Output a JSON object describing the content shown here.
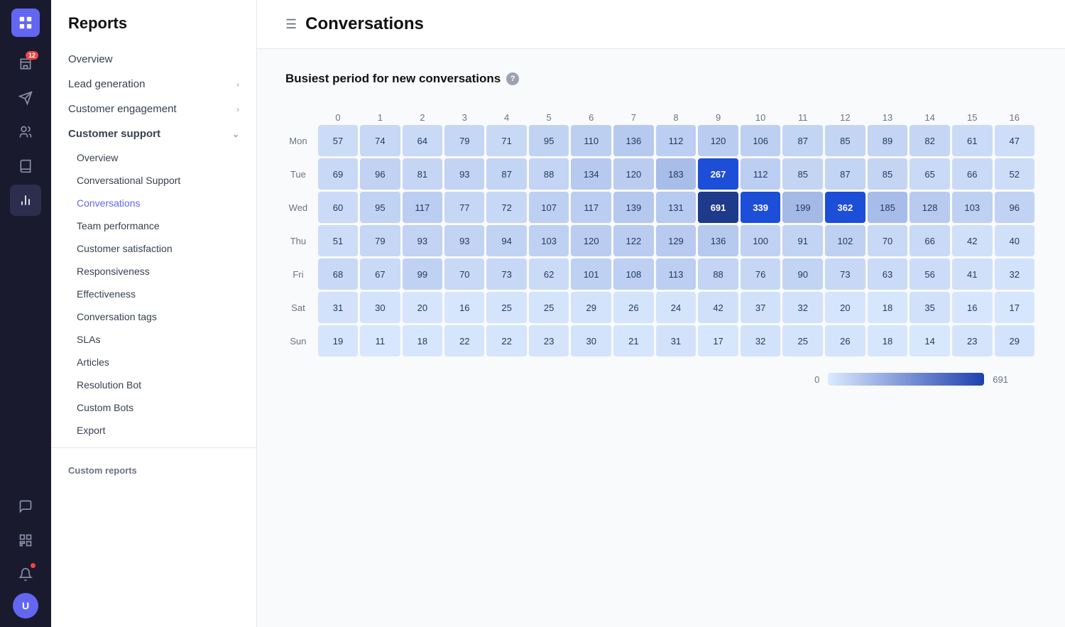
{
  "app": {
    "title": "Reports"
  },
  "icon_sidebar": {
    "badge": "12",
    "nav_icons": [
      {
        "name": "inbox-icon",
        "label": "Inbox",
        "active": false
      },
      {
        "name": "send-icon",
        "label": "Send",
        "active": false
      },
      {
        "name": "contacts-icon",
        "label": "Contacts",
        "active": false
      },
      {
        "name": "knowledge-icon",
        "label": "Knowledge",
        "active": false
      },
      {
        "name": "reports-icon",
        "label": "Reports",
        "active": true
      },
      {
        "name": "apps-icon",
        "label": "Apps",
        "active": false
      }
    ]
  },
  "left_nav": {
    "title": "Reports",
    "items": [
      {
        "label": "Overview",
        "type": "top",
        "active": false
      },
      {
        "label": "Lead generation",
        "type": "top",
        "hasChevron": true,
        "active": false
      },
      {
        "label": "Customer engagement",
        "type": "top",
        "hasChevron": true,
        "active": false
      },
      {
        "label": "Customer support",
        "type": "section",
        "hasChevron": true,
        "active": false
      },
      {
        "label": "Overview",
        "type": "sub",
        "active": false
      },
      {
        "label": "Conversational Support",
        "type": "sub",
        "active": false
      },
      {
        "label": "Conversations",
        "type": "sub",
        "active": true
      },
      {
        "label": "Team performance",
        "type": "sub",
        "active": false
      },
      {
        "label": "Customer satisfaction",
        "type": "sub",
        "active": false
      },
      {
        "label": "Responsiveness",
        "type": "sub",
        "active": false
      },
      {
        "label": "Effectiveness",
        "type": "sub",
        "active": false
      },
      {
        "label": "Conversation tags",
        "type": "sub",
        "active": false
      },
      {
        "label": "SLAs",
        "type": "sub",
        "active": false
      },
      {
        "label": "Articles",
        "type": "sub",
        "active": false
      },
      {
        "label": "Resolution Bot",
        "type": "sub",
        "active": false
      },
      {
        "label": "Custom Bots",
        "type": "sub",
        "active": false
      },
      {
        "label": "Export",
        "type": "sub",
        "active": false
      }
    ],
    "custom_reports_label": "Custom reports"
  },
  "main": {
    "header_icon": "☰",
    "title": "Conversations",
    "section_title": "Busiest period for new conversations",
    "days": [
      "Mon",
      "Tue",
      "Wed",
      "Thu",
      "Fri",
      "Sat",
      "Sun"
    ],
    "hours": [
      "0",
      "1",
      "2",
      "3",
      "4",
      "5",
      "6",
      "7",
      "8",
      "9",
      "10",
      "11",
      "12",
      "13",
      "14",
      "15",
      "16"
    ],
    "heatmap": [
      [
        57,
        74,
        64,
        79,
        71,
        95,
        110,
        136,
        112,
        120,
        106,
        87,
        85,
        89,
        82,
        61,
        47
      ],
      [
        69,
        96,
        81,
        93,
        87,
        88,
        134,
        120,
        183,
        267,
        112,
        85,
        87,
        85,
        65,
        66,
        52
      ],
      [
        60,
        95,
        117,
        77,
        72,
        107,
        117,
        139,
        131,
        691,
        339,
        199,
        362,
        185,
        128,
        103,
        96
      ],
      [
        51,
        79,
        93,
        93,
        94,
        103,
        120,
        122,
        129,
        136,
        100,
        91,
        102,
        70,
        66,
        42,
        40
      ],
      [
        68,
        67,
        99,
        70,
        73,
        62,
        101,
        108,
        113,
        88,
        76,
        90,
        73,
        63,
        56,
        41,
        32
      ],
      [
        31,
        30,
        20,
        16,
        25,
        25,
        29,
        26,
        24,
        42,
        37,
        32,
        20,
        18,
        35,
        16,
        17
      ],
      [
        19,
        11,
        18,
        22,
        22,
        23,
        30,
        21,
        31,
        17,
        32,
        25,
        26,
        18,
        14,
        23,
        29
      ]
    ],
    "legend_min": "0",
    "legend_max": "691"
  }
}
